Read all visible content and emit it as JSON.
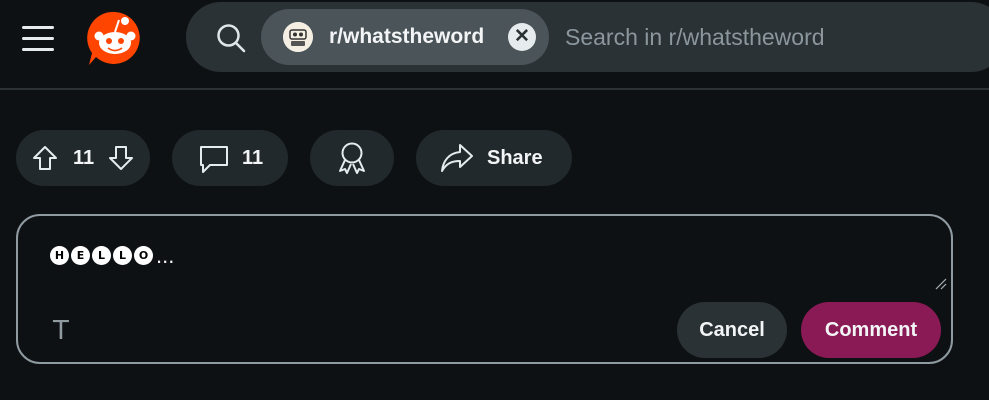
{
  "header": {
    "menu_icon": "hamburger-menu-icon",
    "logo_icon": "reddit-logo-icon",
    "search": {
      "icon": "search-icon",
      "chip_label": "r/whatstheword",
      "chip_avatar": "subreddit-avatar-icon",
      "chip_clear_icon": "close-icon",
      "placeholder": "Search in r/whatstheword"
    }
  },
  "actions": {
    "vote_count": "11",
    "comment_count": "11",
    "share_label": "Share",
    "icons": [
      "upvote-icon",
      "downvote-icon",
      "comment-icon",
      "award-icon",
      "share-icon"
    ]
  },
  "composer": {
    "text_letters": [
      "H",
      "E",
      "L",
      "L",
      "O"
    ],
    "text_suffix": "...",
    "format_label": "T",
    "cancel_label": "Cancel",
    "comment_label": "Comment"
  },
  "colors": {
    "background": "#0e1113",
    "search_bg": "#2a3236",
    "chip_bg": "#4a5459",
    "pill_bg": "#22292c",
    "accent_orange": "#ff4500",
    "comment_button": "#8a1a55"
  }
}
